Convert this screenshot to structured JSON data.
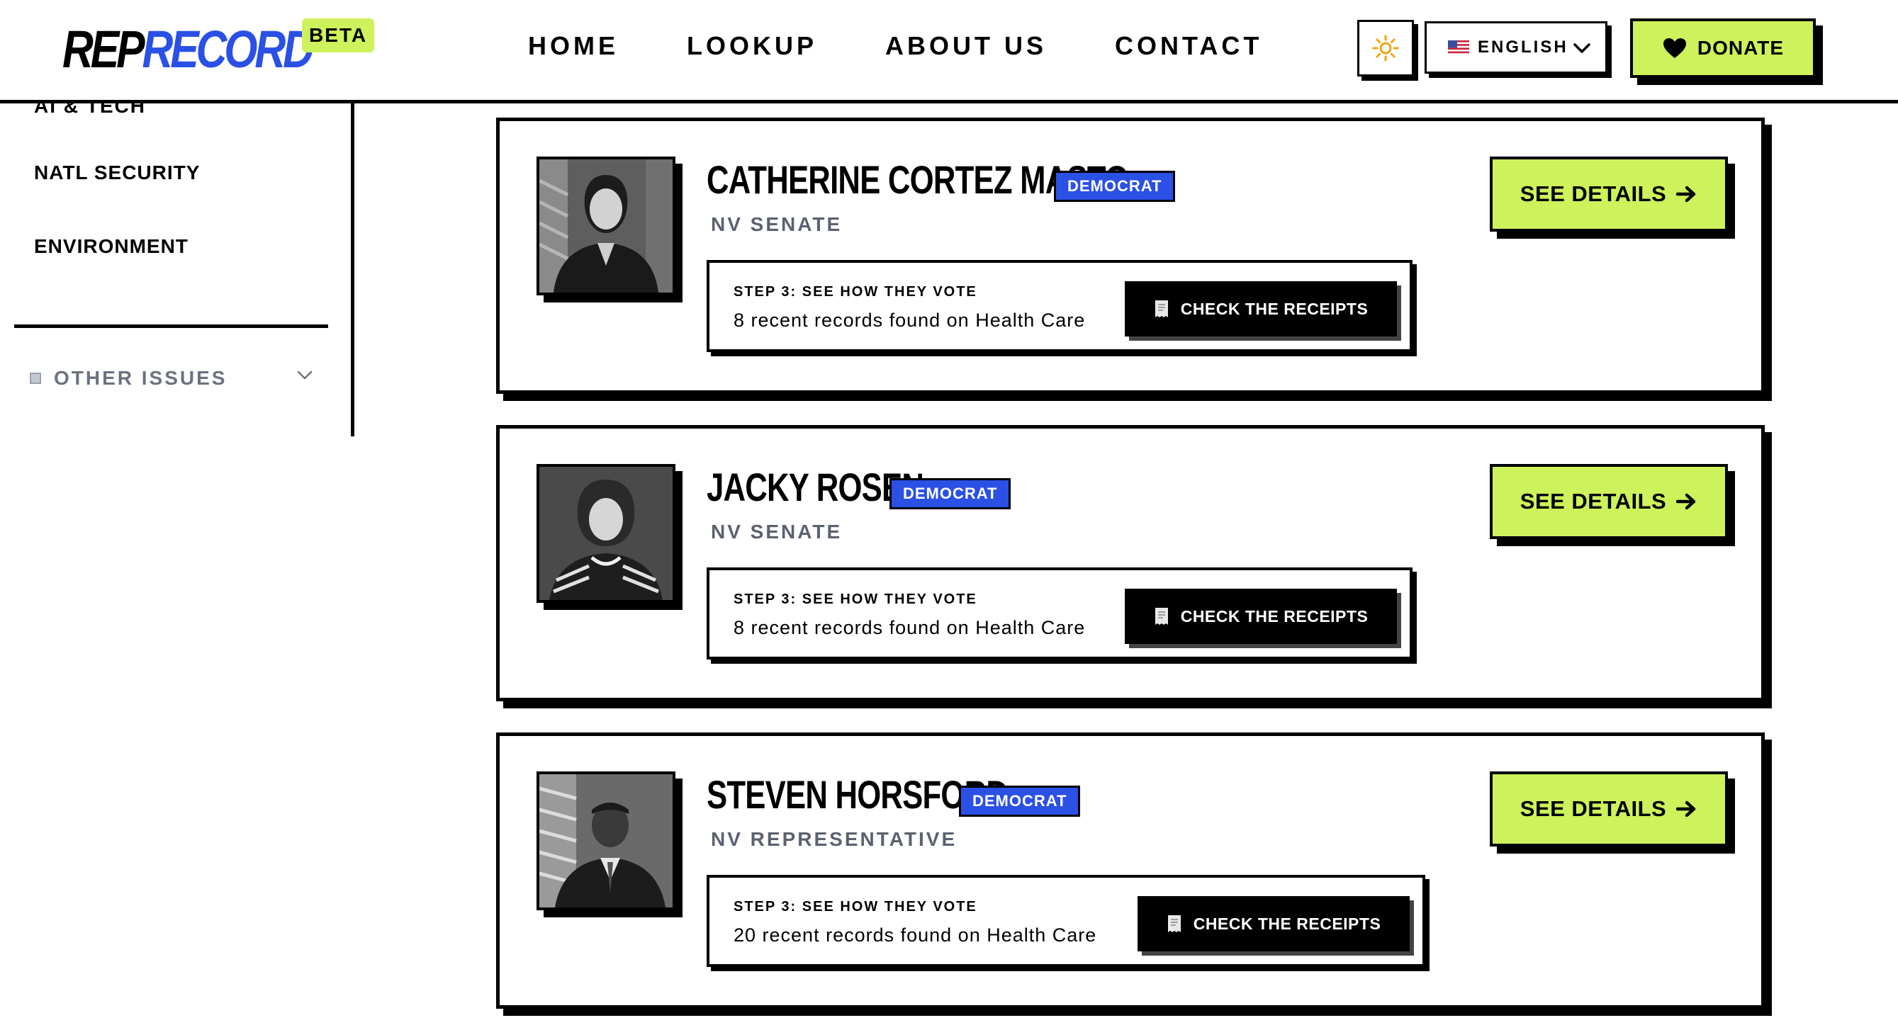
{
  "header": {
    "logo_rep": "REP",
    "logo_record": "RECORD",
    "beta": "BETA",
    "nav": [
      "HOME",
      "LOOKUP",
      "ABOUT US",
      "CONTACT"
    ],
    "language": "ENGLISH",
    "donate": "DONATE"
  },
  "sidebar": {
    "cut_item": "AI & TECH",
    "items": [
      "NATL SECURITY",
      "ENVIRONMENT"
    ],
    "other_issues": "OTHER ISSUES"
  },
  "reps": [
    {
      "name": "CATHERINE CORTEZ MASTO",
      "party": "DEMOCRAT",
      "office": "NV SENATE",
      "step_title": "STEP 3: SEE HOW THEY VOTE",
      "records": "8 recent records found on Health Care",
      "receipts": "CHECK THE RECEIPTS",
      "details": "SEE DETAILS"
    },
    {
      "name": "JACKY ROSEN",
      "party": "DEMOCRAT",
      "office": "NV SENATE",
      "step_title": "STEP 3: SEE HOW THEY VOTE",
      "records": "8 recent records found on Health Care",
      "receipts": "CHECK THE RECEIPTS",
      "details": "SEE DETAILS"
    },
    {
      "name": "STEVEN HORSFORD",
      "party": "DEMOCRAT",
      "office": "NV REPRESENTATIVE",
      "step_title": "STEP 3: SEE HOW THEY VOTE",
      "records": "20 recent records found on Health Care",
      "receipts": "CHECK THE RECEIPTS",
      "details": "SEE DETAILS"
    }
  ],
  "colors": {
    "accent_lime": "#cdf25b",
    "party_blue": "#2b50e6",
    "muted_text": "#5b6170"
  },
  "icons": {
    "theme": "sun-icon",
    "language_flag": "us-flag-icon",
    "donate": "heart-icon",
    "receipts": "receipt-icon",
    "details": "arrow-right-icon",
    "dropdown": "chevron-down-icon"
  }
}
